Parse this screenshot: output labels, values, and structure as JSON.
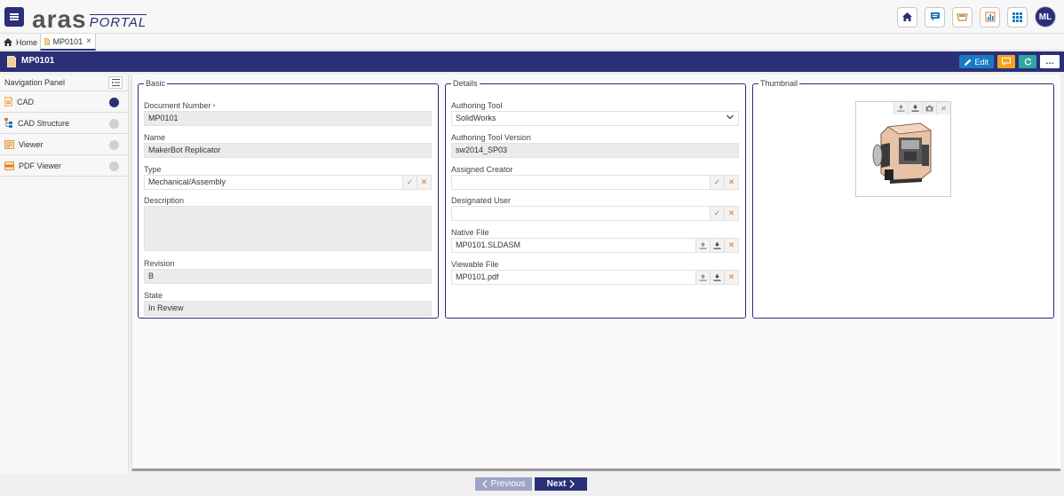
{
  "header": {
    "logo_main": "aras",
    "logo_sub": "PORTAL",
    "user_initials": "ML",
    "icons": [
      "home-icon",
      "chat-icon",
      "basket-icon",
      "report-icon",
      "apps-grid-icon"
    ]
  },
  "tabs": [
    {
      "label": "Home",
      "icon": "home-icon"
    },
    {
      "label": "MP0101",
      "icon": "document-icon",
      "closable": true
    }
  ],
  "titlebar": {
    "title": "MP0101",
    "edit_label": "Edit",
    "more_label": "…"
  },
  "nav": {
    "title": "Navigation Panel",
    "items": [
      {
        "label": "CAD",
        "icon": "document-icon",
        "active": true
      },
      {
        "label": "CAD Structure",
        "icon": "structure-icon",
        "active": false
      },
      {
        "label": "Viewer",
        "icon": "viewer-icon",
        "active": false
      },
      {
        "label": "PDF Viewer",
        "icon": "pdf-icon",
        "active": false
      }
    ]
  },
  "basic": {
    "legend": "Basic",
    "document_number_label": "Document Number",
    "document_number": "MP0101",
    "name_label": "Name",
    "name": "MakerBot Replicator",
    "type_label": "Type",
    "type": "Mechanical/Assembly",
    "description_label": "Description",
    "description": "",
    "revision_label": "Revision",
    "revision": "B",
    "state_label": "State",
    "state": "In Review"
  },
  "details": {
    "legend": "Details",
    "authoring_tool_label": "Authoring Tool",
    "authoring_tool": "SolidWorks",
    "authoring_tool_version_label": "Authoring Tool Version",
    "authoring_tool_version": "sw2014_SP03",
    "assigned_creator_label": "Assigned Creator",
    "assigned_creator": "",
    "designated_user_label": "Designated User",
    "designated_user": "",
    "native_file_label": "Native File",
    "native_file": "MP0101.SLDASM",
    "viewable_file_label": "Viewable File",
    "viewable_file": "MP0101.pdf"
  },
  "thumbnail": {
    "legend": "Thumbnail"
  },
  "footer": {
    "previous_label": "Previous",
    "next_label": "Next"
  },
  "colors": {
    "brand": "#2a2f78",
    "edit": "#1a7ac0",
    "orange": "#f0a520",
    "teal": "#2fa6a0"
  }
}
